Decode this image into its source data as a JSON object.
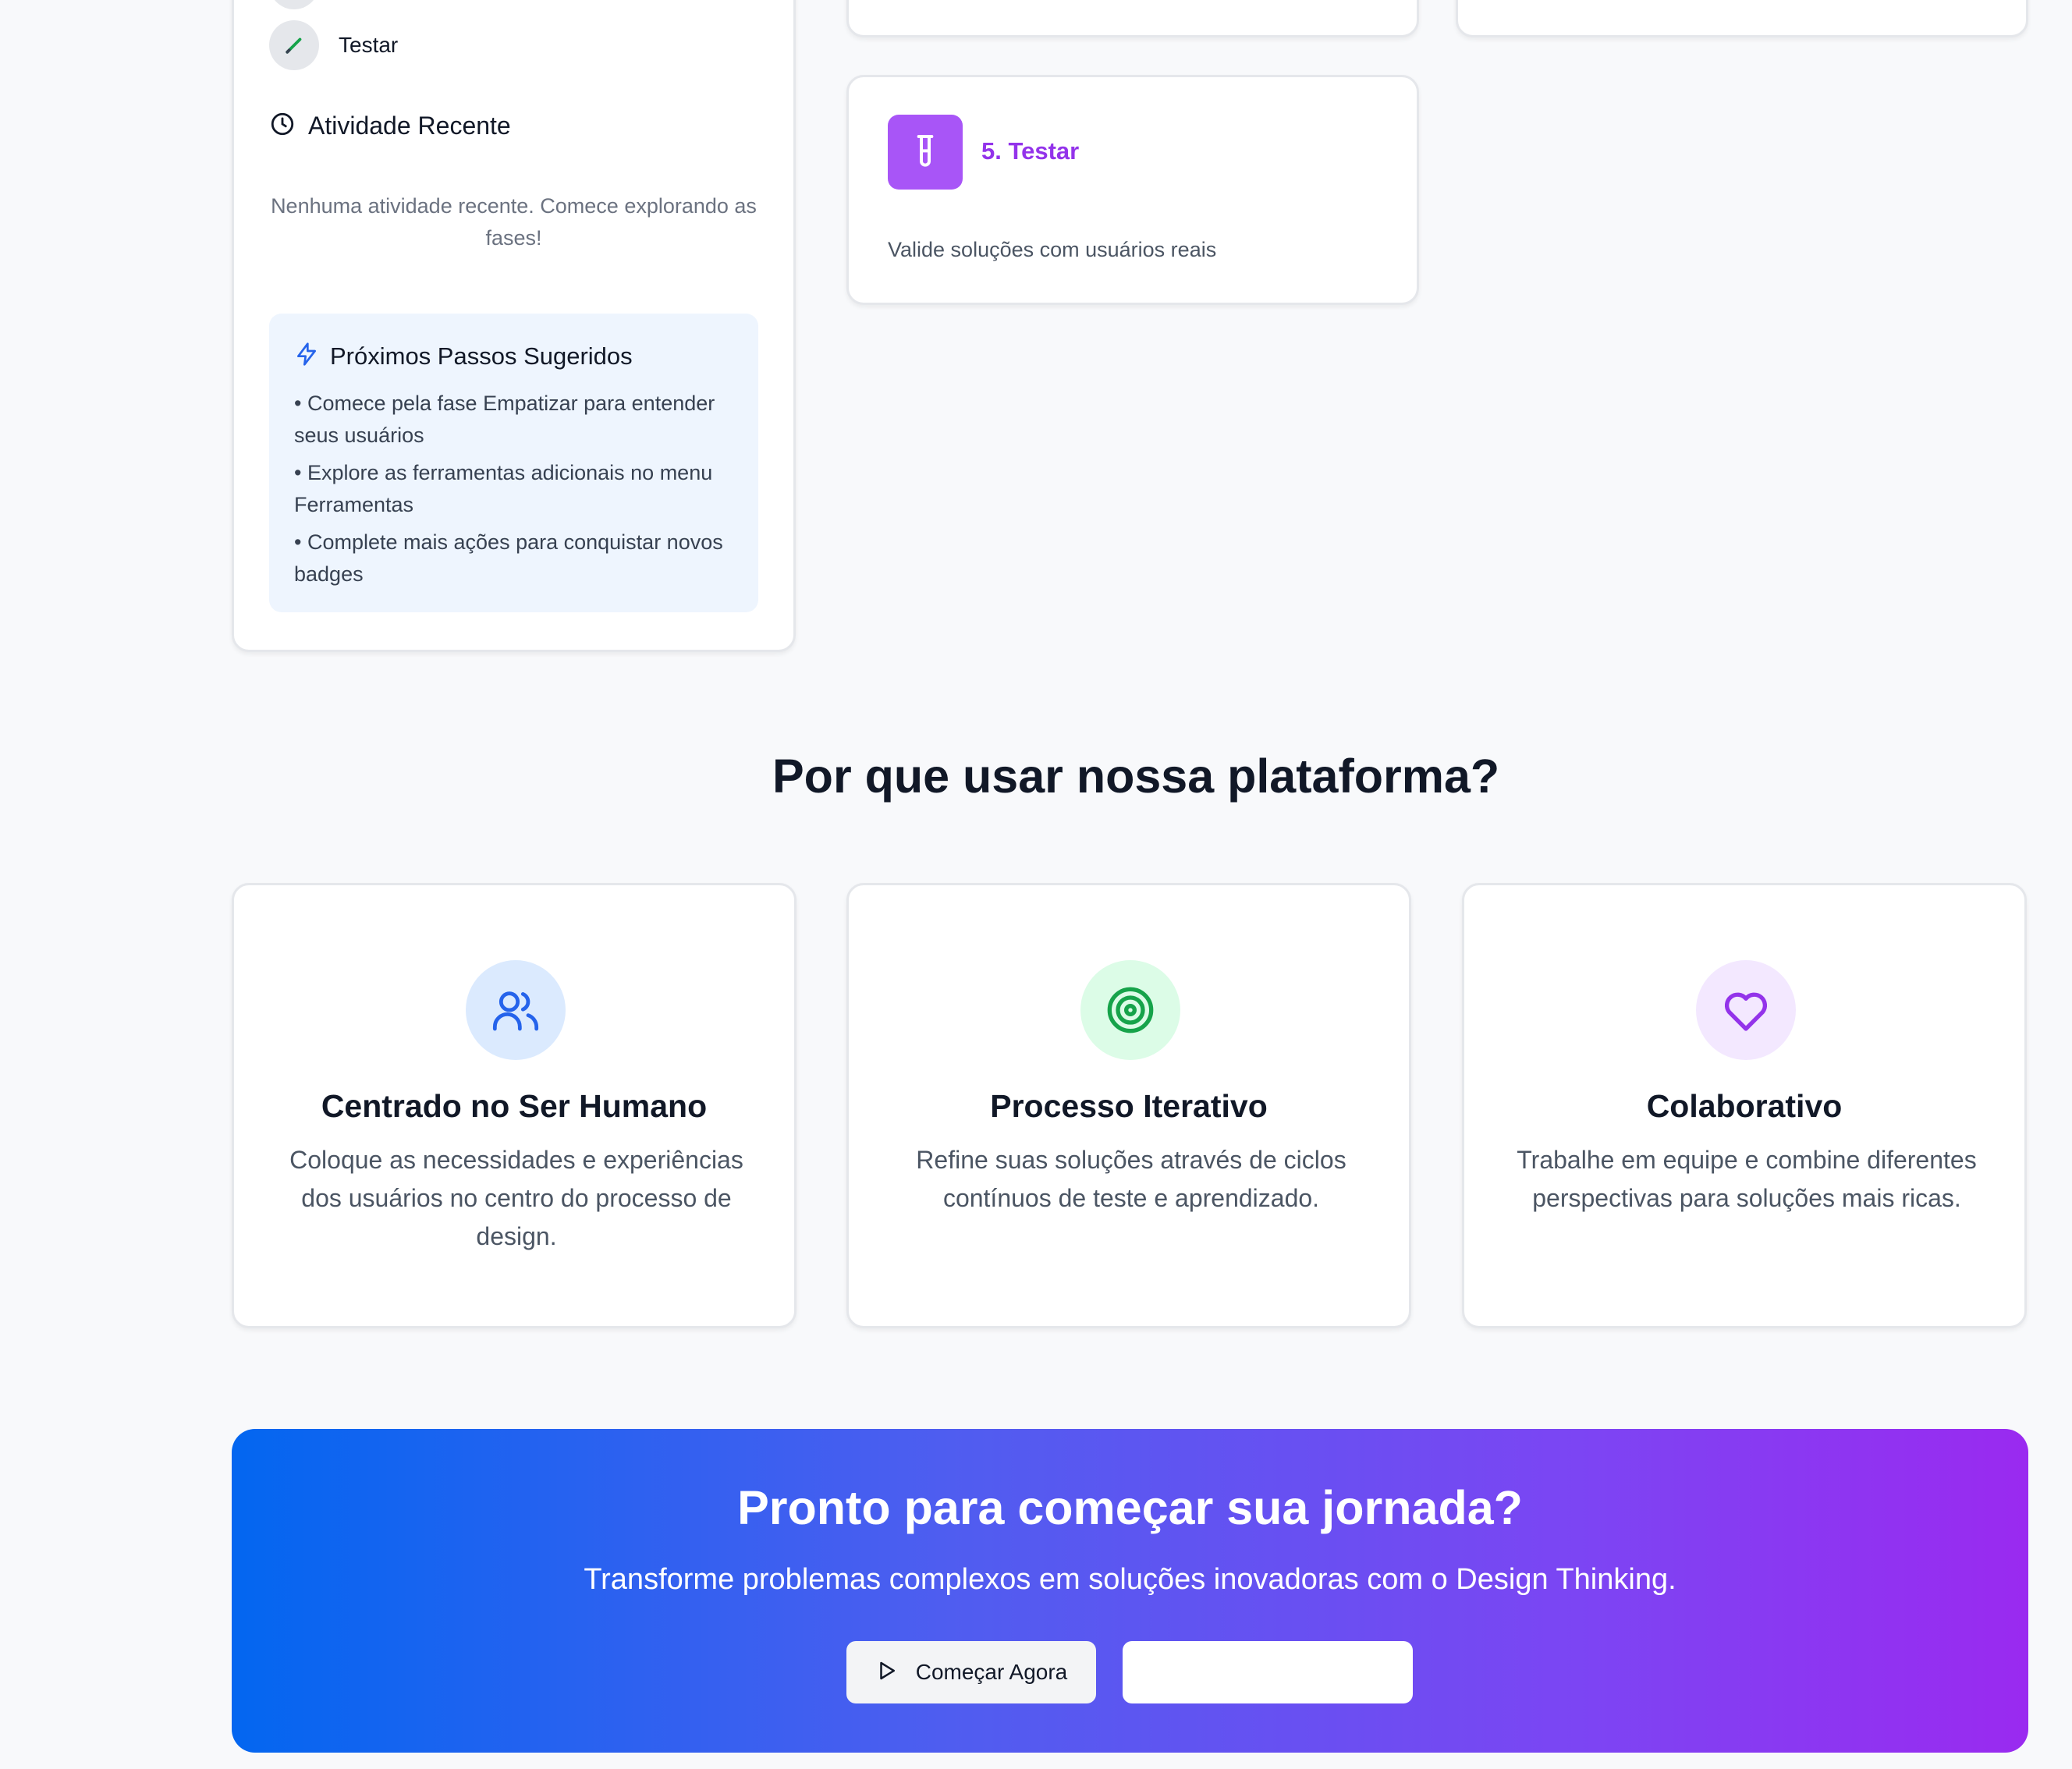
{
  "progress": {
    "phase_item": {
      "label": "Testar",
      "icon": "pencil-icon"
    },
    "recent": {
      "title": "Atividade Recente",
      "empty_text": "Nenhuma atividade recente. Comece explorando as fases!"
    },
    "next_steps": {
      "title": "Próximos Passos Sugeridos",
      "items": [
        "• Comece pela fase Empatizar para entender seus usuários",
        "• Explore as ferramentas adicionais no menu Ferramentas",
        "• Complete mais ações para conquistar novos badges"
      ]
    }
  },
  "phase_cards": {
    "test": {
      "title": "5. Testar",
      "description": "Valide soluções com usuários reais",
      "icon": "test-tube-icon",
      "color": "#a855f7"
    }
  },
  "why": {
    "title": "Por que usar nossa plataforma?",
    "features": [
      {
        "title": "Centrado no Ser Humano",
        "description": "Coloque as necessidades e experiências dos usuários no centro do processo de design.",
        "icon": "users-icon",
        "color": "#2563eb",
        "bg": "#dbeafe"
      },
      {
        "title": "Processo Iterativo",
        "description": "Refine suas soluções através de ciclos contínuos de teste e aprendizado.",
        "icon": "target-icon",
        "color": "#16a34a",
        "bg": "#dcfce7"
      },
      {
        "title": "Colaborativo",
        "description": "Trabalhe em equipe e combine diferentes perspectivas para soluções mais ricas.",
        "icon": "heart-icon",
        "color": "#9333ea",
        "bg": "#f3e8ff"
      }
    ]
  },
  "cta": {
    "title": "Pronto para começar sua jornada?",
    "subtitle": "Transforme problemas complexos em soluções inovadoras com o Design Thinking.",
    "start_label": "Começar Agora",
    "secondary_label": ""
  }
}
